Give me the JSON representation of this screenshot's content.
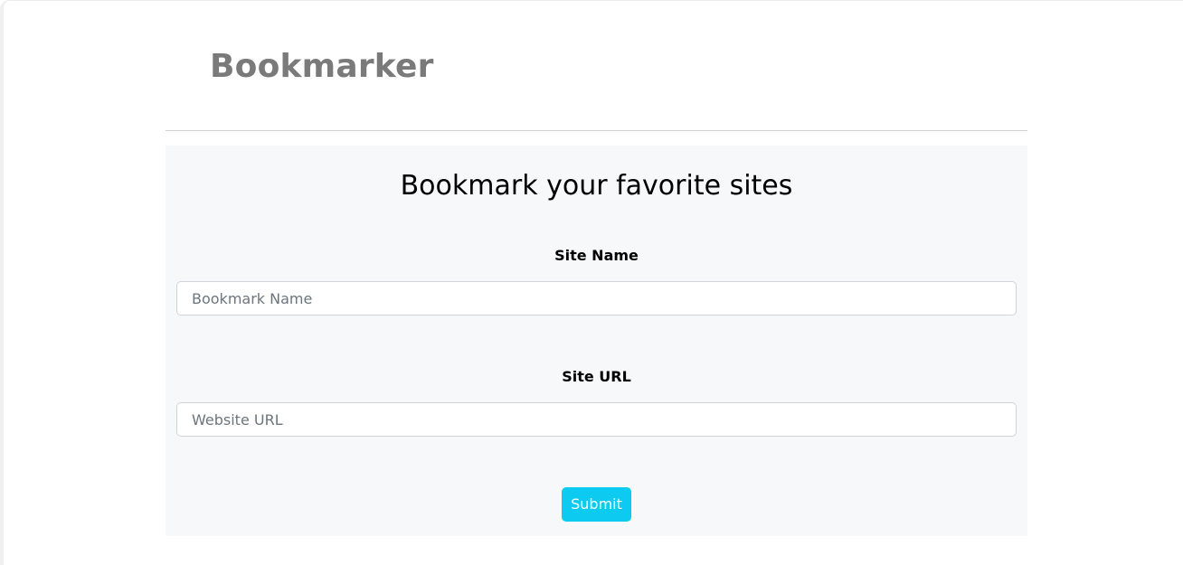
{
  "header": {
    "title": "Bookmarker"
  },
  "form": {
    "heading": "Bookmark your favorite sites",
    "site_name": {
      "label": "Site Name",
      "placeholder": "Bookmark Name",
      "value": ""
    },
    "site_url": {
      "label": "Site URL",
      "placeholder": "Website URL",
      "value": ""
    },
    "submit_label": "Submit"
  },
  "colors": {
    "title_text": "#7a7a7a",
    "panel_background": "#f7f8fa",
    "submit_button": "#0dcaf0",
    "input_border": "#ced4da"
  }
}
